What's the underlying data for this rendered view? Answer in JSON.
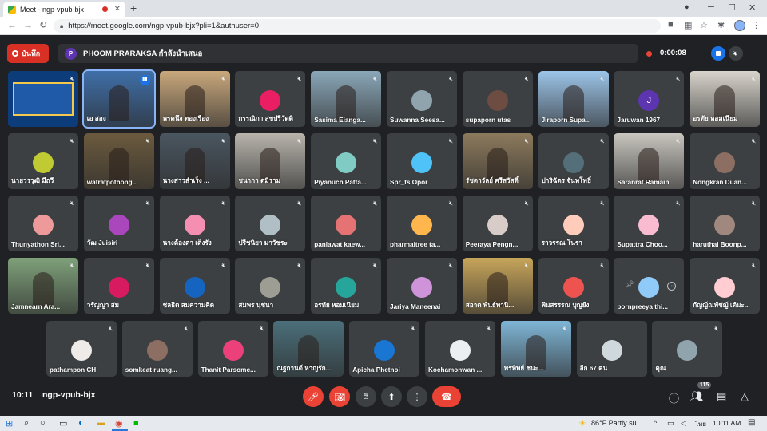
{
  "browser": {
    "tab_title": "Meet - ngp-vpub-bjx",
    "url": "https://meet.google.com/ngp-vpub-bjx?pli=1&authuser=0",
    "new_tab": "+",
    "close": "✕",
    "minimize": "─",
    "maximize": "☐",
    "window_close": "✕"
  },
  "meet": {
    "record_label": "บันทึก",
    "presenter_initial": "P",
    "presenting_text": "PHOOM PRARAKSA กำลังนำเสนอ",
    "record_time": "0:00:08",
    "clock": "10:11",
    "meeting_code": "ngp-vpub-bjx",
    "participant_count": "115"
  },
  "tiles": [
    {
      "name": "",
      "kind": "screen",
      "mute": true
    },
    {
      "name": "เอ สอง",
      "kind": "video",
      "bg": "#3f6fa8",
      "speaking": true
    },
    {
      "name": "พรคนึง ทองเรือง",
      "kind": "video",
      "bg": "#c9a87c",
      "mute": true
    },
    {
      "name": "กรรณิกา สุขปรีวัตติ",
      "kind": "avatar",
      "avatar_color": "#e91e63",
      "avatar_text": "",
      "mute": true
    },
    {
      "name": "Sasima Eianga...",
      "kind": "video",
      "bg": "#8aa7b8",
      "mute": true
    },
    {
      "name": "Suwanna Seesa...",
      "kind": "avatar",
      "avatar_color": "#90a4ae",
      "avatar_text": "",
      "mute": true
    },
    {
      "name": "supaporn utas",
      "kind": "avatar",
      "avatar_color": "#6d4c41",
      "avatar_text": "",
      "mute": true
    },
    {
      "name": "Jiraporn Supa...",
      "kind": "video",
      "bg": "#9cc4e8",
      "mute": true
    },
    {
      "name": "Jaruwan 1967",
      "kind": "avatar",
      "avatar_color": "#5e35b1",
      "avatar_text": "J",
      "mute": true
    },
    {
      "name": "อรทัย หอมเนียม",
      "kind": "video",
      "bg": "#d8d4cc",
      "mute": true
    },
    {
      "name": "นายวรวุฒิ มีถวี",
      "kind": "avatar",
      "avatar_color": "#c0ca33",
      "avatar_text": "",
      "mute": true
    },
    {
      "name": "watratpothong...",
      "kind": "video",
      "bg": "#6b5a3e",
      "mute": true
    },
    {
      "name": "นางสาวสำเร็ง ...",
      "kind": "video",
      "bg": "#4a5660",
      "mute": true
    },
    {
      "name": "ชนากา ดมิราม",
      "kind": "video",
      "bg": "#b8b4ac",
      "mute": true
    },
    {
      "name": "Piyanuch Patta...",
      "kind": "avatar",
      "avatar_color": "#80cbc4",
      "avatar_text": "",
      "mute": true
    },
    {
      "name": "Spr_ts Opor",
      "kind": "avatar",
      "avatar_color": "#4fc3f7",
      "avatar_text": "",
      "mute": true
    },
    {
      "name": "รัชดาวัลย์ ศรีสวัสดิ์",
      "kind": "video",
      "bg": "#8d7a5c",
      "mute": true
    },
    {
      "name": "ปาริฉัตร จันทโพธิ์",
      "kind": "avatar",
      "avatar_color": "#546e7a",
      "avatar_text": "",
      "mute": true
    },
    {
      "name": "Saranrat Ramain",
      "kind": "video",
      "bg": "#c9c6bf",
      "mute": true
    },
    {
      "name": "Nongkran Duan...",
      "kind": "avatar",
      "avatar_color": "#8d6e63",
      "avatar_text": "",
      "mute": true
    },
    {
      "name": "Thunyathon Sri...",
      "kind": "avatar",
      "avatar_color": "#ef9a9a",
      "avatar_text": "",
      "mute": true
    },
    {
      "name": "วัฒ Juisiri",
      "kind": "avatar",
      "avatar_color": "#ab47bc",
      "avatar_text": "",
      "mute": true
    },
    {
      "name": "นางต้องตา เต็งรัง",
      "kind": "avatar",
      "avatar_color": "#f48fb1",
      "avatar_text": "",
      "mute": true
    },
    {
      "name": "ปรีชนิยา มาวัชระ",
      "kind": "avatar",
      "avatar_color": "#b0bec5",
      "avatar_text": "",
      "mute": true
    },
    {
      "name": "panlawat kaew...",
      "kind": "avatar",
      "avatar_color": "#e57373",
      "avatar_text": "",
      "mute": true
    },
    {
      "name": "pharmaitree ta...",
      "kind": "avatar",
      "avatar_color": "#ffb74d",
      "avatar_text": "",
      "mute": true
    },
    {
      "name": "Peeraya Pengn...",
      "kind": "avatar",
      "avatar_color": "#d7ccc8",
      "avatar_text": "",
      "mute": true
    },
    {
      "name": "ราวรรณ โนรา",
      "kind": "avatar",
      "avatar_color": "#ffccbc",
      "avatar_text": "",
      "mute": true
    },
    {
      "name": "Supattra Choo...",
      "kind": "avatar",
      "avatar_color": "#f8bbd0",
      "avatar_text": "",
      "mute": true
    },
    {
      "name": "haruthai Boonp...",
      "kind": "avatar",
      "avatar_color": "#a1887f",
      "avatar_text": "",
      "mute": true
    },
    {
      "name": "Jamnearn Ara...",
      "kind": "video",
      "bg": "#7fa07a",
      "mute": true
    },
    {
      "name": "วรัญญา สม",
      "kind": "avatar",
      "avatar_color": "#d81b60",
      "avatar_text": "",
      "mute": true
    },
    {
      "name": "ชลธิด สมความคิด",
      "kind": "avatar",
      "avatar_color": "#1565c0",
      "avatar_text": "",
      "mute": true
    },
    {
      "name": "สมพร นุชนา",
      "kind": "avatar",
      "avatar_color": "#9e9d94",
      "avatar_text": "",
      "mute": true
    },
    {
      "name": "อรทัย หอมเนียม",
      "kind": "avatar",
      "avatar_color": "#26a69a",
      "avatar_text": "",
      "mute": true
    },
    {
      "name": "Jariya Maneenai",
      "kind": "avatar",
      "avatar_color": "#ce93d8",
      "avatar_text": "",
      "mute": true
    },
    {
      "name": "สอาด พันธ์พานิ...",
      "kind": "video",
      "bg": "#c7a55a",
      "mute": true
    },
    {
      "name": "พิมสรรรณ บุญยัง",
      "kind": "avatar",
      "avatar_color": "#ef5350",
      "avatar_text": "",
      "mute": true
    },
    {
      "name": "pornpreeya thi...",
      "kind": "avatar",
      "avatar_color": "#90caf9",
      "avatar_text": "",
      "mute": false,
      "hover": true
    },
    {
      "name": "กัญญ์ณพัชญ์ เต้มะ...",
      "kind": "avatar",
      "avatar_color": "#ffcdd2",
      "avatar_text": "",
      "mute": true
    },
    {
      "name": "pathampon CH",
      "kind": "avatar",
      "avatar_color": "#efebe9",
      "avatar_text": "",
      "mute": true
    },
    {
      "name": "somkeat ruang...",
      "kind": "avatar",
      "avatar_color": "#8d6e63",
      "avatar_text": "",
      "mute": true
    },
    {
      "name": "Thanit Parsomc...",
      "kind": "avatar",
      "avatar_color": "#ec407a",
      "avatar_text": "",
      "mute": true
    },
    {
      "name": "ณฐกานต์ หาญรัก...",
      "kind": "video",
      "bg": "#4b6f7a",
      "mute": false
    },
    {
      "name": "Apicha Phetnoi",
      "kind": "avatar",
      "avatar_color": "#1976d2",
      "avatar_text": "",
      "mute": true
    },
    {
      "name": "Kochamonwan ...",
      "kind": "avatar",
      "avatar_color": "#eceff1",
      "avatar_text": "",
      "mute": true
    },
    {
      "name": "พรทิพย์ ชนะ...",
      "kind": "video",
      "bg": "#7fb6d6",
      "mute": true
    },
    {
      "name": "อีก 67 คน",
      "kind": "avatar",
      "avatar_color": "#cfd8dc",
      "avatar_text": "",
      "mute": false
    },
    {
      "name": "คุณ",
      "kind": "avatar",
      "avatar_color": "#90a4ae",
      "avatar_text": "",
      "mute": true
    }
  ],
  "icons": {
    "mute": "🔇︎",
    "pin": "📌︎",
    "more": "⋯",
    "mic_off": "🎤︎",
    "cam_off": "📷︎",
    "hand": "✋︎",
    "present": "⬆",
    "options": "⋮",
    "end_call": "☎",
    "info": "ⓘ",
    "people": "👥︎",
    "chat": "▤",
    "activities": "△"
  },
  "taskbar": {
    "weather": "86°F  Partly su...",
    "lang": "ไทย",
    "clock": "10:11 AM"
  }
}
